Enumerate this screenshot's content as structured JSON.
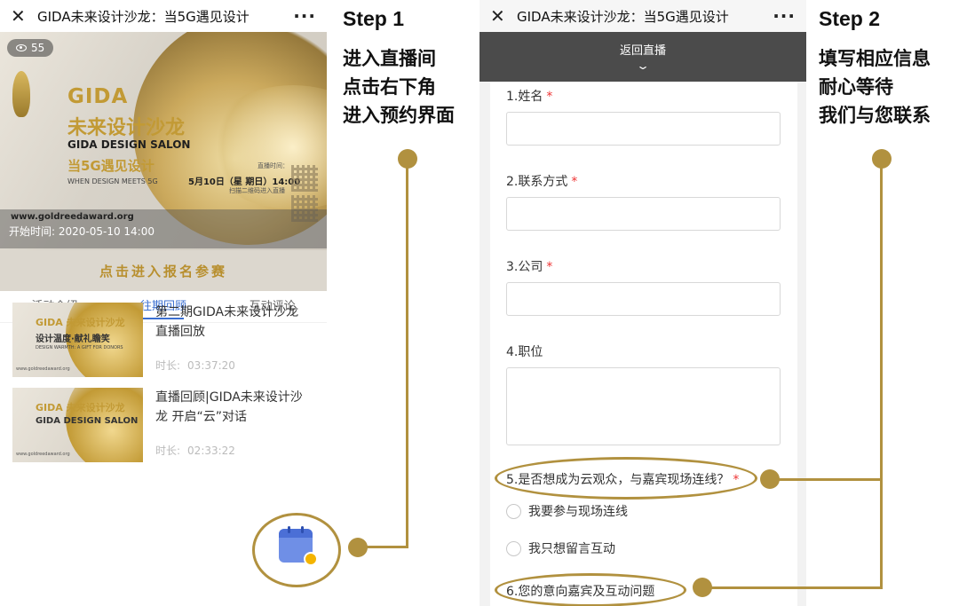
{
  "left_phone": {
    "title": "GIDA未来设计沙龙：当5G遇见设计",
    "close_icon": "close-icon",
    "more_icon": "more-icon",
    "banner": {
      "views": "55",
      "gida": "GIDA",
      "cn_title": "未来设计沙龙",
      "en_title": "GIDA DESIGN SALON",
      "subtitle": "当5G遇见设计",
      "tagline": "WHEN DESIGN MEETS 5G",
      "live_label": "直播时间：",
      "live_date": "5月10日（星 期日）14:00",
      "qr_tip": "扫描二维码进入直播",
      "url": "www.goldreedaward.org",
      "start_time": "开始时间: 2020-05-10 14:00",
      "cta": "点击进入报名参赛"
    },
    "tabs": [
      "活动介绍",
      "往期回顾",
      "互动评论"
    ],
    "active_tab": 1,
    "records": [
      {
        "title": "第二期GIDA未来设计沙龙直播回放",
        "duration_label": "时长:",
        "duration": "03:37:20",
        "thumb_title": "GIDA 未来设计沙龙",
        "thumb_sub": "设计温度·献礼瞻笑",
        "thumb_en": "DESIGN WARMTH: A GIFT FOR DONORS",
        "thumb_url": "www.goldreedaward.org"
      },
      {
        "title": "直播回顾|GIDA未来设计沙龙 开启“云”对话",
        "duration_label": "时长:",
        "duration": "02:33:22",
        "thumb_title": "GIDA 未来设计沙龙",
        "thumb_sub": "GIDA DESIGN SALON",
        "thumb_en": "",
        "thumb_url": "www.goldreedaward.org"
      }
    ],
    "calendar_button_icon": "calendar-icon"
  },
  "right_phone": {
    "title": "GIDA未来设计沙龙：当5G遇见设计",
    "back_label": "返回直播",
    "questions": [
      {
        "label": "1.姓名",
        "required": true
      },
      {
        "label": "2.联系方式",
        "required": true
      },
      {
        "label": "3.公司",
        "required": true
      },
      {
        "label": "4.职位",
        "required": false
      },
      {
        "label": "5.是否想成为云观众，与嘉宾现场连线？",
        "required": true
      },
      {
        "label": "6.您的意向嘉宾及互动问题",
        "required": false
      }
    ],
    "q5_options": [
      "我要参与现场连线",
      "我只想留言互动"
    ],
    "required_mark": "*"
  },
  "annotations": {
    "step1": {
      "title": "Step 1",
      "lines": [
        "进入直播间",
        "点击右下角",
        "进入预约界面"
      ]
    },
    "step2": {
      "title": "Step 2",
      "lines": [
        "填写相应信息",
        "耐心等待",
        "我们与您联系"
      ]
    },
    "accent_color": "#b1913f"
  }
}
